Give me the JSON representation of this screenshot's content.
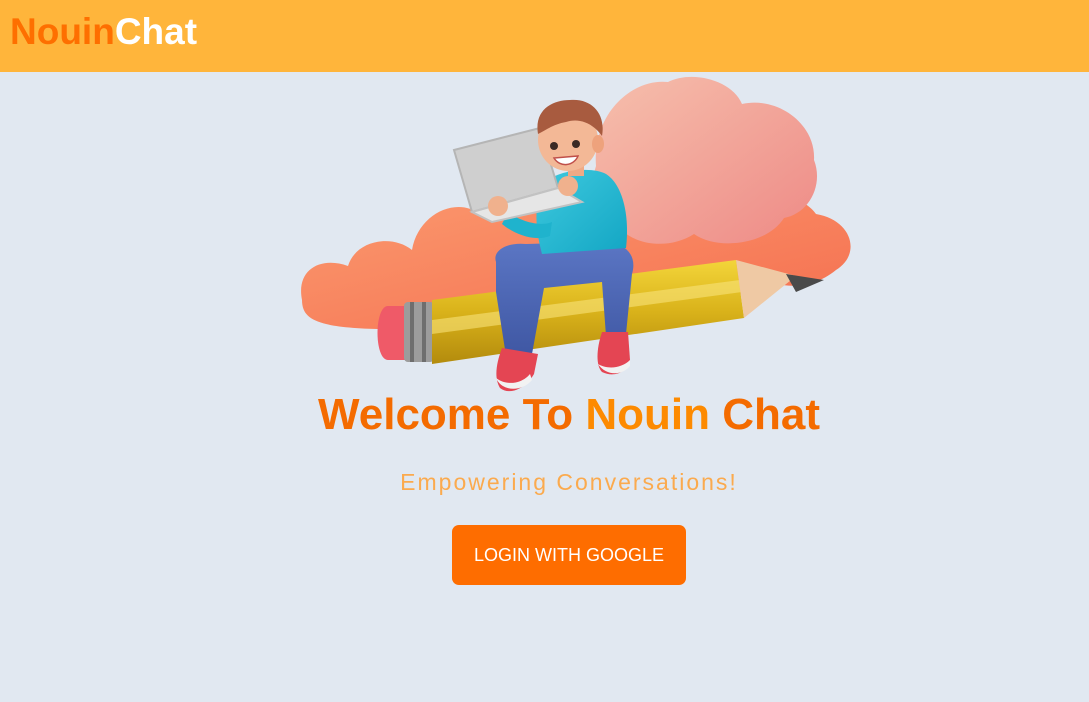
{
  "header": {
    "brand_part1": "Nouin",
    "brand_part2": "Chat",
    "background_color": "#ffb53b"
  },
  "hero": {
    "illustration": "boy-riding-pencil-with-laptop-illustration"
  },
  "welcome": {
    "part1": "Welcome To ",
    "part2": "Nouin",
    "part3": " Chat"
  },
  "tagline": "Empowering Conversations!",
  "login_button": {
    "label": "LOGIN WITH GOOGLE",
    "color": "#fe6d00"
  },
  "colors": {
    "page_background": "#e1e8f1",
    "accent_orange": "#fe6f00",
    "tagline_orange": "#fbaa4e"
  }
}
